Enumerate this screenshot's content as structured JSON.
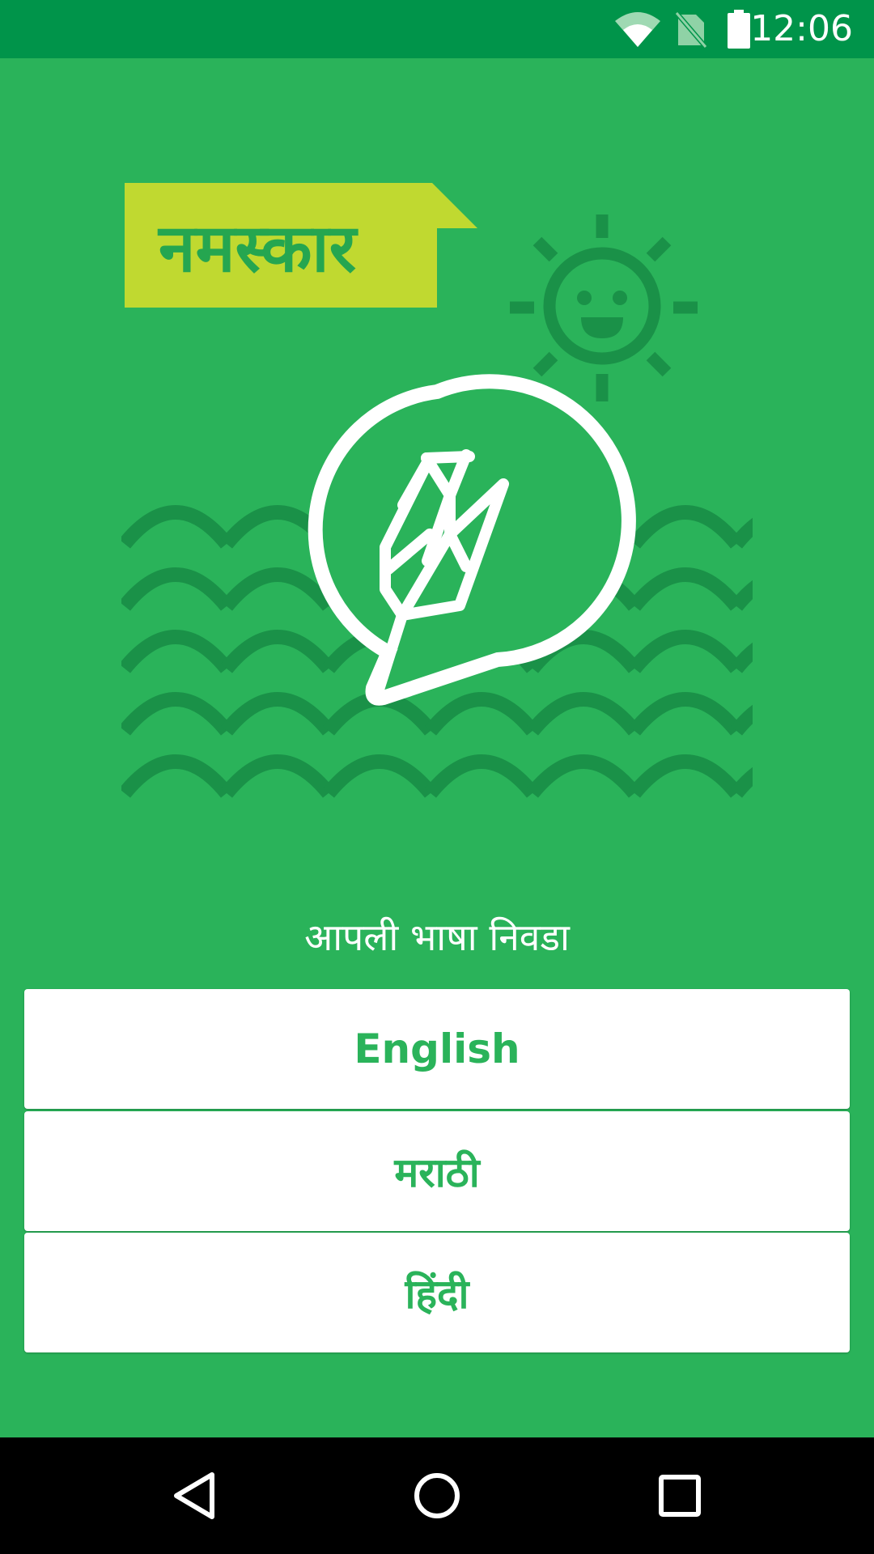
{
  "status_bar": {
    "time": "12:06",
    "icons": [
      "wifi-icon",
      "no-sim-icon",
      "battery-icon"
    ]
  },
  "illustration": {
    "greeting": "नमस्कार",
    "icons": [
      "sun-icon",
      "wheat-logo-icon",
      "field-waves"
    ]
  },
  "prompt": "आपली भाषा निवडा",
  "languages": [
    {
      "label": "English"
    },
    {
      "label": "मराठी"
    },
    {
      "label": "हिंदी"
    }
  ],
  "nav_bar": {
    "icons": [
      "back-icon",
      "home-icon",
      "recents-icon"
    ]
  },
  "colors": {
    "background": "#2ab35a",
    "status_bar": "#00944a",
    "greeting_badge": "#c0d930",
    "illustration_dark": "#1a9148",
    "button_text": "#2ab35a"
  }
}
